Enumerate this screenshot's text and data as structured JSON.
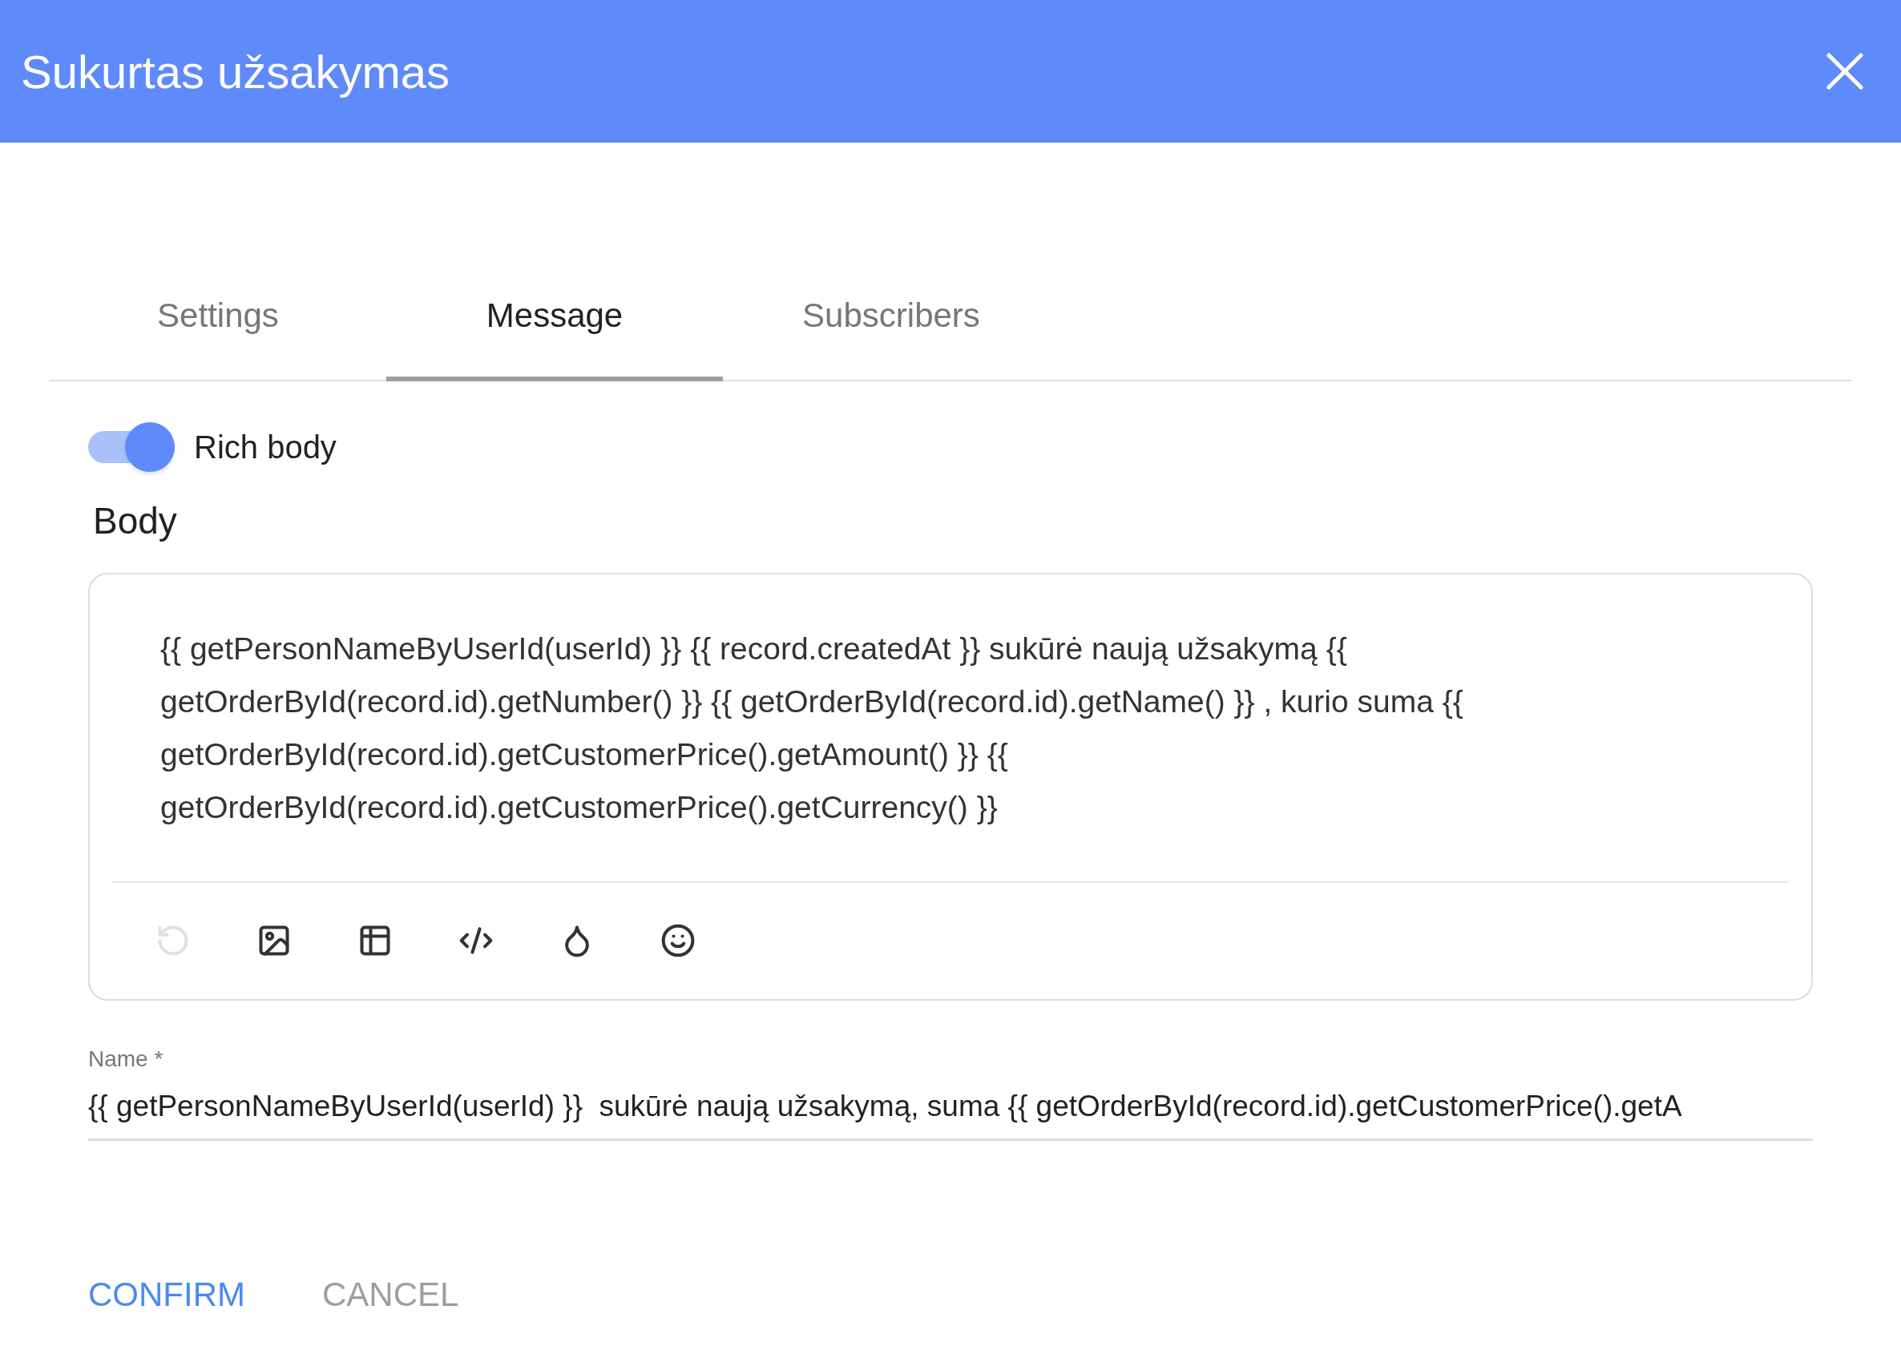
{
  "dialog": {
    "title": "Sukurtas užsakymas"
  },
  "tabs": [
    {
      "label": "Settings",
      "selected": false
    },
    {
      "label": "Message",
      "selected": true
    },
    {
      "label": "Subscribers",
      "selected": false
    }
  ],
  "rich_body": {
    "label": "Rich body",
    "on": true
  },
  "body": {
    "label": "Body",
    "value": "{{ getPersonNameByUserId(userId) }} {{ record.createdAt }} sukūrė naują užsakymą {{ getOrderById(record.id).getNumber() }} {{ getOrderById(record.id).getName() }} , kurio suma {{ getOrderById(record.id).getCustomerPrice().getAmount() }} {{ getOrderById(record.id).getCustomerPrice().getCurrency() }}"
  },
  "toolbar": [
    {
      "kind": "undo",
      "disabled": true
    },
    {
      "kind": "image",
      "disabled": false
    },
    {
      "kind": "table",
      "disabled": false
    },
    {
      "kind": "code",
      "disabled": false
    },
    {
      "kind": "color",
      "disabled": false
    },
    {
      "kind": "emoji",
      "disabled": false
    }
  ],
  "name_field": {
    "label": "Name *",
    "value": "{{ getPersonNameByUserId(userId) }}  sukūrė naują užsakymą, suma {{ getOrderById(record.id).getCustomerPrice().getA"
  },
  "buttons": [
    {
      "label": "CONFIRM",
      "kind": "primary"
    },
    {
      "label": "CANCEL",
      "kind": "secondary"
    }
  ]
}
